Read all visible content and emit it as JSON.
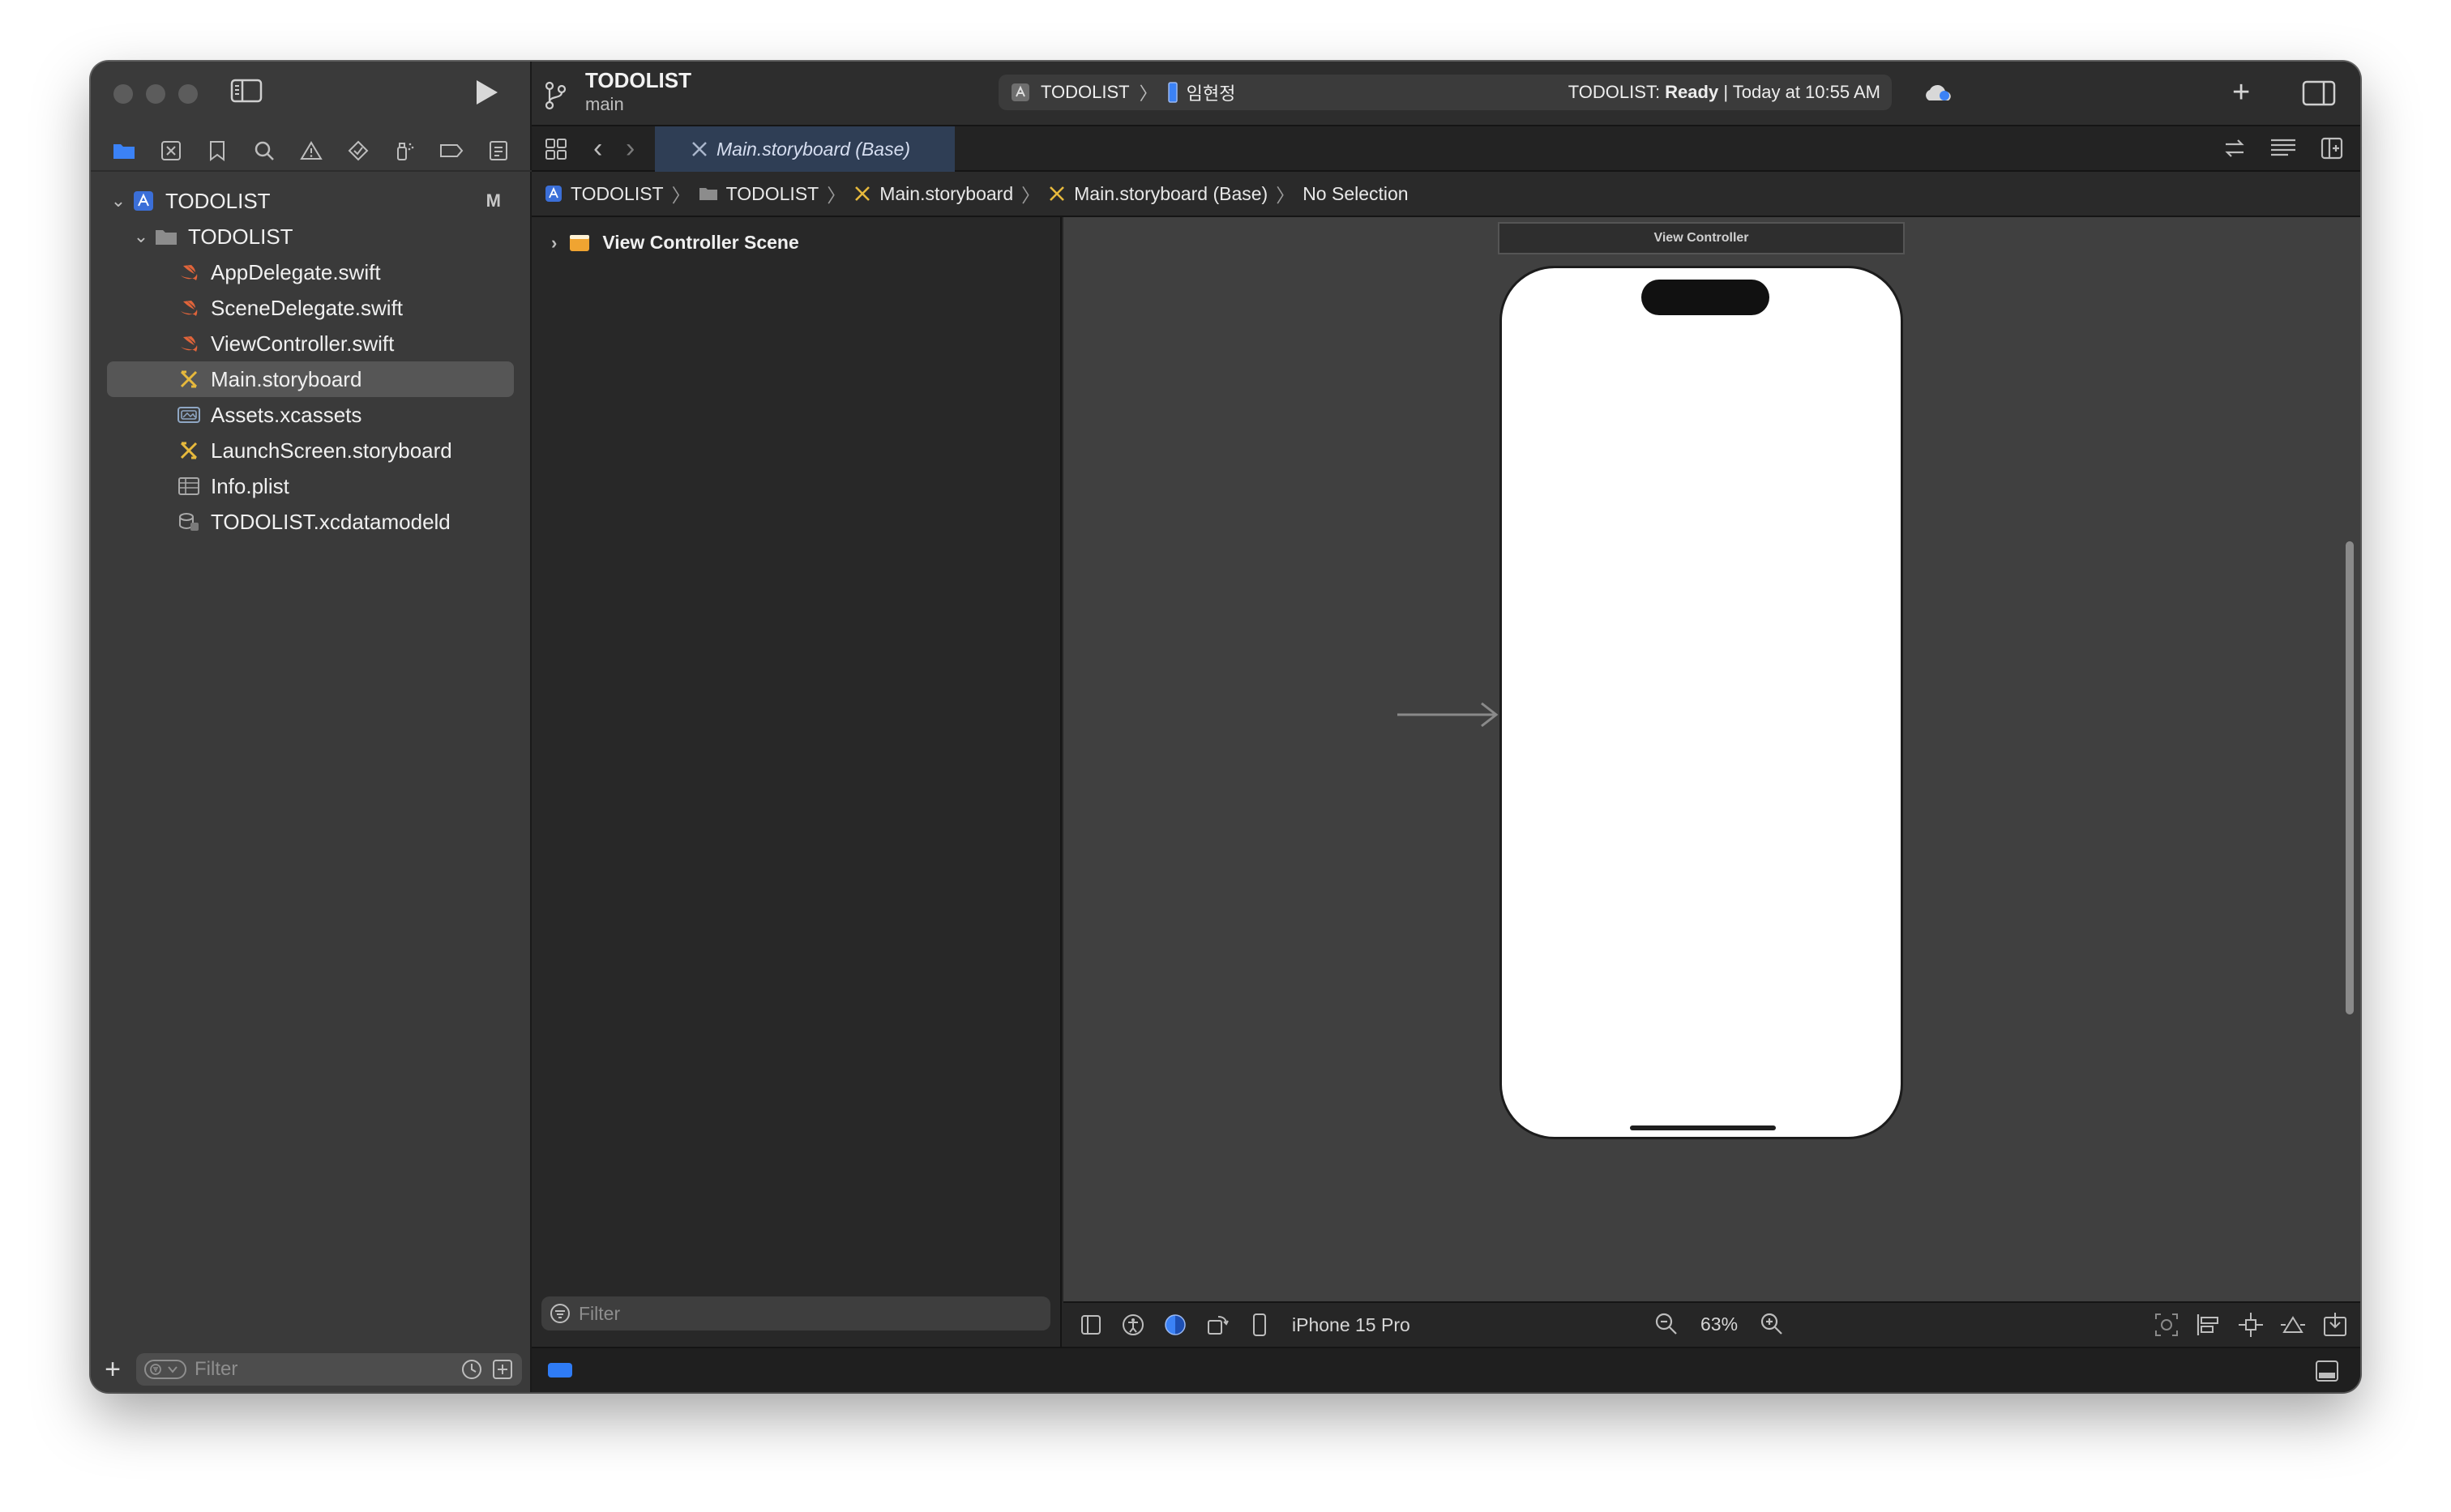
{
  "sidebar": {
    "project": "TODOLIST",
    "project_status": "M",
    "group": "TODOLIST",
    "files": [
      {
        "name": "AppDelegate.swift",
        "icon": "swift-file-icon"
      },
      {
        "name": "SceneDelegate.swift",
        "icon": "swift-file-icon"
      },
      {
        "name": "ViewController.swift",
        "icon": "swift-file-icon"
      },
      {
        "name": "Main.storyboard",
        "icon": "storyboard-file-icon"
      },
      {
        "name": "Assets.xcassets",
        "icon": "assets-catalog-icon"
      },
      {
        "name": "LaunchScreen.storyboard",
        "icon": "storyboard-file-icon"
      },
      {
        "name": "Info.plist",
        "icon": "plist-file-icon"
      },
      {
        "name": "TODOLIST.xcdatamodeld",
        "icon": "data-model-icon"
      }
    ],
    "selected_file": "Main.storyboard",
    "filter_placeholder": "Filter"
  },
  "toolbar": {
    "project_name": "TODOLIST",
    "branch": "main",
    "scheme": "TODOLIST",
    "destination": "임현정",
    "status_prefix": "TODOLIST: ",
    "status_state": "Ready",
    "status_time": " | Today at 10:55 AM"
  },
  "tab": {
    "label": "Main.storyboard (Base)"
  },
  "jumpbar": {
    "items": [
      "TODOLIST",
      "TODOLIST",
      "Main.storyboard",
      "Main.storyboard (Base)",
      "No Selection"
    ]
  },
  "outline": {
    "scene": "View Controller Scene",
    "filter_placeholder": "Filter"
  },
  "canvas": {
    "scene_label": "View Controller",
    "device": "iPhone 15 Pro",
    "zoom": "63%"
  },
  "colors": {
    "accent": "#2f7cf6",
    "storyboard_icon": "#e7b93c",
    "swift_icon": "#e0643a",
    "scene_icon": "#f0a431"
  }
}
